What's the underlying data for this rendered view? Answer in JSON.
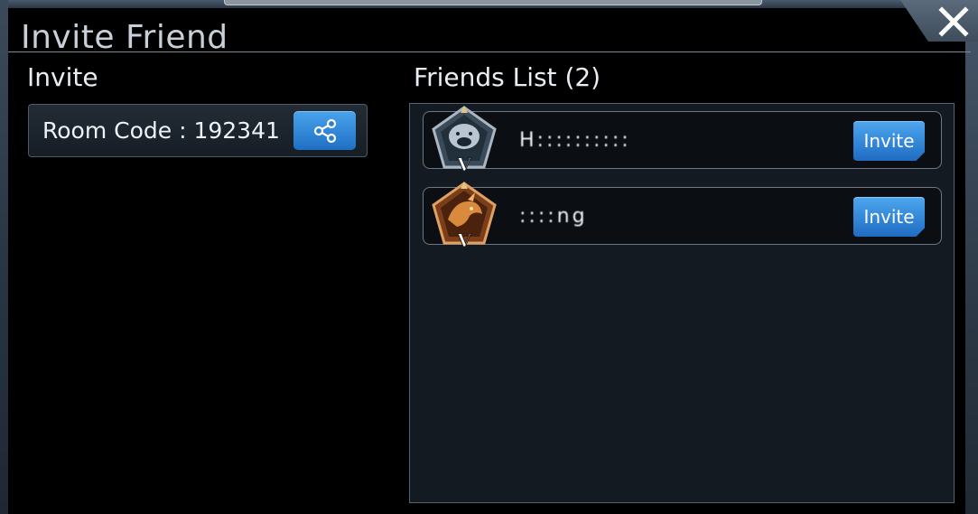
{
  "window": {
    "title": "Invite Friend"
  },
  "invite_section": {
    "label": "Invite",
    "room_code_text": "Room Code : 192341"
  },
  "friends_section": {
    "label": "Friends List (2)",
    "friends": [
      {
        "name": "H::::::::::",
        "rank": "V",
        "avatar": "bear-emblem-icon",
        "invite_label": "Invite"
      },
      {
        "name": "::::ng",
        "rank": "V",
        "avatar": "dragon-emblem-icon",
        "invite_label": "Invite"
      }
    ]
  },
  "colors": {
    "accent": "#2f86d8",
    "panel_border": "#556271",
    "title_text": "#c7cfd8"
  }
}
